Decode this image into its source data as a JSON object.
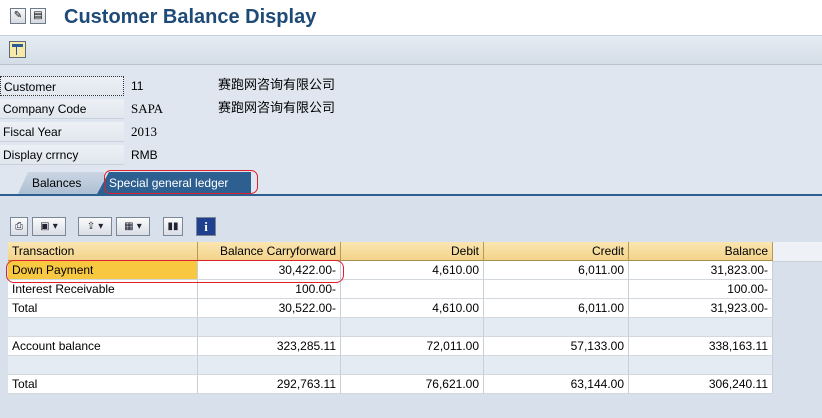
{
  "window": {
    "title": "Customer Balance Display"
  },
  "header_fields": [
    {
      "label": "Customer",
      "value": "11",
      "description": "赛跑网咨询有限公司"
    },
    {
      "label": "Company Code",
      "value": "SAPA",
      "description": "赛跑网咨询有限公司"
    },
    {
      "label": "Fiscal Year",
      "value": "2013",
      "description": ""
    },
    {
      "label": "Display crrncy",
      "value": "RMB",
      "description": ""
    }
  ],
  "tabs": [
    {
      "label": "Balances"
    },
    {
      "label": "Special general ledger"
    }
  ],
  "table": {
    "columns": [
      "Transaction",
      "Balance Carryforward",
      "Debit",
      "Credit",
      "Balance"
    ],
    "rows": [
      [
        "Down Payment",
        "30,422.00-",
        "4,610.00",
        "6,011.00",
        "31,823.00-"
      ],
      [
        "Interest Receivable",
        "100.00-",
        "",
        "",
        "100.00-"
      ],
      [
        "Total",
        "30,522.00-",
        "4,610.00",
        "6,011.00",
        "31,923.00-"
      ],
      [
        "",
        "",
        "",
        "",
        ""
      ],
      [
        "Account balance",
        "323,285.11",
        "72,011.00",
        "57,133.00",
        "338,163.11"
      ],
      [
        "",
        "",
        "",
        "",
        ""
      ],
      [
        "Total",
        "292,763.11",
        "76,621.00",
        "63,144.00",
        "306,240.11"
      ]
    ]
  },
  "icons": {
    "titlebar": [
      "display-change-icon",
      "document-icon"
    ],
    "apptoolbar": [
      "layout-icon"
    ],
    "alv_toolbar": [
      "print-icon",
      "print-preview-icon",
      "export-icon",
      "column-layout-icon",
      "chart-icon",
      "information-icon"
    ]
  },
  "colors": {
    "title": "#1e4a78",
    "active_tab": "#2e5f91",
    "table_header": "#f2d38a",
    "selected_cell": "#f8c940",
    "annotation": "#e0202a"
  }
}
